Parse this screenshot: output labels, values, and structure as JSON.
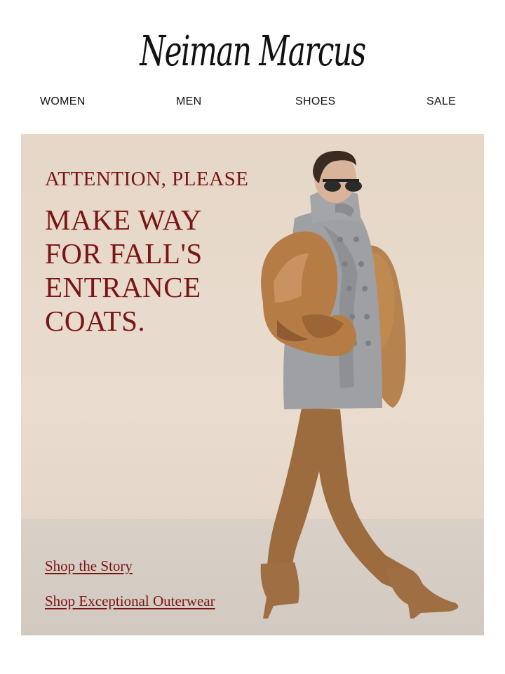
{
  "brand": {
    "logo_text": "Neiman Marcus"
  },
  "nav": {
    "items": [
      {
        "label": "WOMEN"
      },
      {
        "label": "MEN"
      },
      {
        "label": "SHOES"
      },
      {
        "label": "SALE"
      }
    ]
  },
  "hero": {
    "eyebrow": "ATTENTION, PLEASE",
    "headline_lines": [
      "MAKE WAY",
      "FOR FALL'S",
      "ENTRANCE",
      "COATS."
    ],
    "links": [
      {
        "label": "Shop the Story"
      },
      {
        "label": "Shop Exceptional Outerwear"
      }
    ],
    "accent_color": "#7a1515",
    "background_color": "#e6d7c8"
  }
}
